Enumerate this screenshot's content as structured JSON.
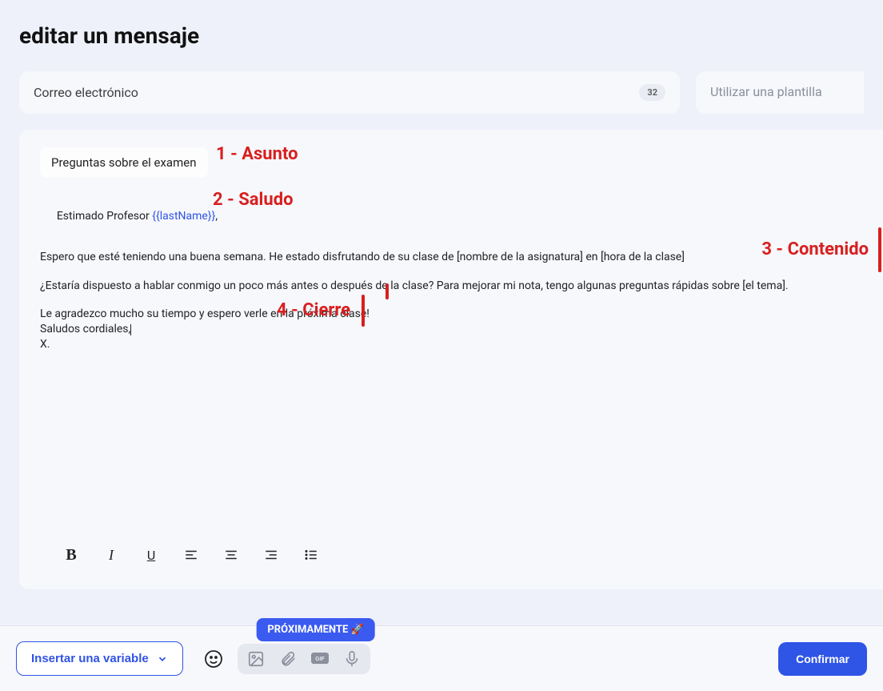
{
  "page": {
    "title": "editar un mensaje"
  },
  "top": {
    "channel_label": "Correo electrónico",
    "char_count": "32",
    "template_label": "Utilizar una plantilla"
  },
  "editor": {
    "subject": "Preguntas sobre el examen",
    "greeting_prefix": "Estimado Profesor ",
    "greeting_var": "{{lastName}}",
    "greeting_suffix": ",",
    "para1": "Espero que esté teniendo una buena semana. He estado disfrutando de su clase de [nombre de la asignatura] en [hora de la clase]",
    "para2": "¿Estaría dispuesto a hablar conmigo un poco más antes o después de la clase? Para mejorar mi nota, tengo algunas preguntas rápidas sobre [el tema].",
    "closing_line1": "Le agradezco mucho su tiempo y espero verle en la próxima clase!",
    "closing_line2": "Saludos cordiales,",
    "closing_line3": "X."
  },
  "annotations": {
    "a1": "1 - Asunto",
    "a2": "2 - Saludo",
    "a3": "3 - Contenido",
    "a4": "4 - Cierre"
  },
  "bottom": {
    "insert_variable": "Insertar una variable",
    "coming_soon": "PRÓXIMAMENTE 🚀",
    "confirm": "Confirmar"
  }
}
